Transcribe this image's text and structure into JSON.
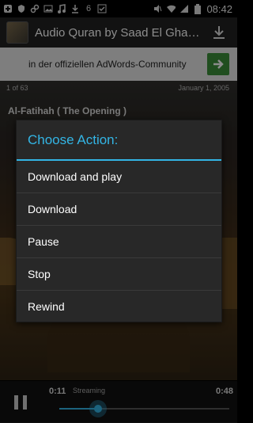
{
  "status_bar": {
    "time": "08:42",
    "left_icons": [
      "add-icon",
      "shield-icon",
      "link-icon",
      "image-icon",
      "music-icon",
      "download-icon",
      "six-icon",
      "check-icon"
    ],
    "right_icons": [
      "mute-icon",
      "wifi-icon",
      "signal-icon",
      "battery-icon"
    ],
    "badge": "6"
  },
  "action_bar": {
    "title": "Audio Quran by Saad El Gha…"
  },
  "ad": {
    "text": "in der offiziellen AdWords-Community"
  },
  "meta": {
    "track_index": "1 of 63",
    "date": "January 1, 2005"
  },
  "surah": "Al-Fatihah ( The Opening )",
  "dialog": {
    "title": "Choose Action:",
    "items": [
      "Download and play",
      "Download",
      "Pause",
      "Stop",
      "Rewind"
    ]
  },
  "player": {
    "elapsed": "0:11",
    "status": "Streaming",
    "total": "0:48",
    "progress": 0.23
  },
  "colors": {
    "accent": "#33b5e5",
    "ad_button": "#3b8e3a"
  }
}
